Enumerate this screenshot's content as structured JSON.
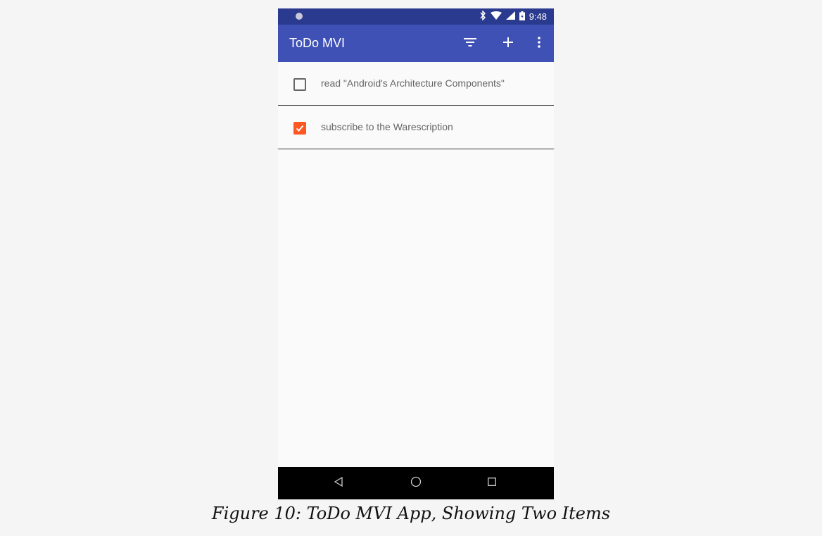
{
  "status_bar": {
    "time": "9:48"
  },
  "app_bar": {
    "title": "ToDo MVI"
  },
  "actions": {
    "filter_icon": "filter-icon",
    "add_icon": "plus-icon",
    "overflow_icon": "more-vert-icon"
  },
  "todos": [
    {
      "text": "read \"Android's Architecture Components\"",
      "checked": false
    },
    {
      "text": "subscribe to the Warescription",
      "checked": true
    }
  ],
  "nav_bar": {
    "back_icon": "back-icon",
    "home_icon": "home-icon",
    "recents_icon": "recents-icon"
  },
  "caption": "Figure 10: ToDo MVI App, Showing Two Items",
  "colors": {
    "status_bar": "#2a3a8f",
    "app_bar": "#3f51b5",
    "checkbox_checked": "#ff5722"
  }
}
